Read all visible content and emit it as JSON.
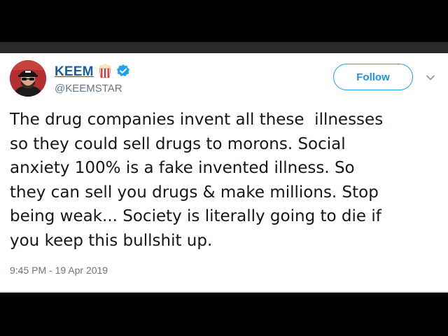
{
  "tweet": {
    "display_name": "KEEM",
    "handle": "@KEEMSTAR",
    "follow_label": "Follow",
    "text_lines": [
      "The drug companies invent all these  illnesses",
      "so they could sell drugs to morons. Social",
      "anxiety 100% is a fake invented illness. So",
      "they can sell you drugs & make millions. Stop",
      "being weak... Society is literally going to die if",
      "you keep this bullshit up."
    ],
    "timestamp": "9:45 PM - 19 Apr 2019",
    "icons": {
      "popcorn": "popcorn-icon",
      "verified": "verified-badge-icon",
      "menu": "chevron-down-icon"
    }
  },
  "colors": {
    "name": "#1b5e9d",
    "follow_accent": "#1da1f2",
    "text": "#14171a",
    "muted": "#657786",
    "verified": "#1da1f2"
  }
}
